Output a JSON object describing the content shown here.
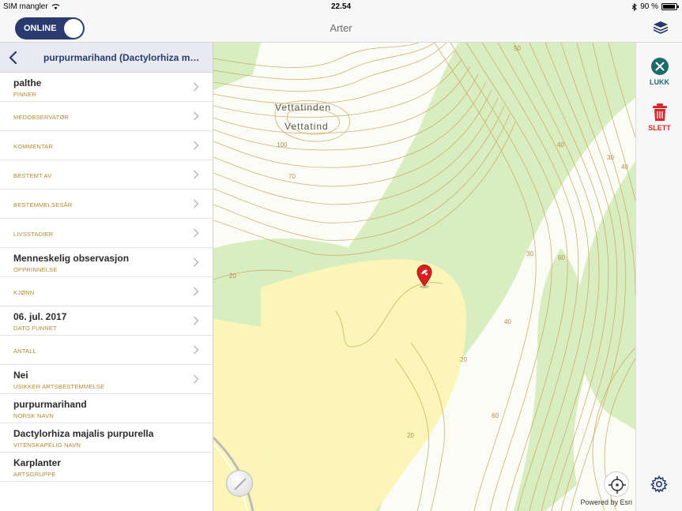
{
  "statusbar": {
    "carrier": "SIM mangler",
    "time": "22.54",
    "battery": "90 %"
  },
  "navbar": {
    "mode_label": "ONLINE",
    "title": "Arter"
  },
  "panel": {
    "title": "purpurmarihand (Dactylorhiza m…",
    "rows": [
      {
        "value": "palthe",
        "label": "FINNER",
        "chevron": true
      },
      {
        "value": "",
        "label": "MEDOBSERVATØR",
        "chevron": true
      },
      {
        "value": "",
        "label": "KOMMENTAR",
        "chevron": true
      },
      {
        "value": "",
        "label": "BESTEMT AV",
        "chevron": true
      },
      {
        "value": "",
        "label": "BESTEMMELSESÅR",
        "chevron": true
      },
      {
        "value": "",
        "label": "LIVSSTADIER",
        "chevron": true
      },
      {
        "value": "Menneskelig observasjon",
        "label": "OPPRINNELSE",
        "chevron": true
      },
      {
        "value": "",
        "label": "KJØNN",
        "chevron": true
      },
      {
        "value": "06. jul. 2017",
        "label": "DATO FUNNET",
        "chevron": true
      },
      {
        "value": "",
        "label": "ANTALL",
        "chevron": true
      },
      {
        "value": "Nei",
        "label": "USIKKER ARTSBESTEMMELSE",
        "chevron": true
      },
      {
        "value": "purpurmarihand",
        "label": "NORSK NAVN",
        "chevron": false
      },
      {
        "value": "Dactylorhiza majalis purpurella",
        "label": "VITENSKAPELIG NAVN",
        "chevron": false
      },
      {
        "value": "Karplanter",
        "label": "ARTSGRUPPE",
        "chevron": false
      }
    ]
  },
  "map": {
    "place_labels": [
      "Vettatinden",
      "Vettatind"
    ],
    "contour_labels": [
      "50",
      "100",
      "70",
      "20",
      "30",
      "40",
      "60",
      "20",
      "40",
      "30",
      "20",
      "60",
      "40"
    ],
    "attribution": "Powered by Esri"
  },
  "toolbar": {
    "close_label": "LUKK",
    "delete_label": "SLETT",
    "colors": {
      "close": "#1e6b6b",
      "delete": "#d9262a"
    }
  }
}
